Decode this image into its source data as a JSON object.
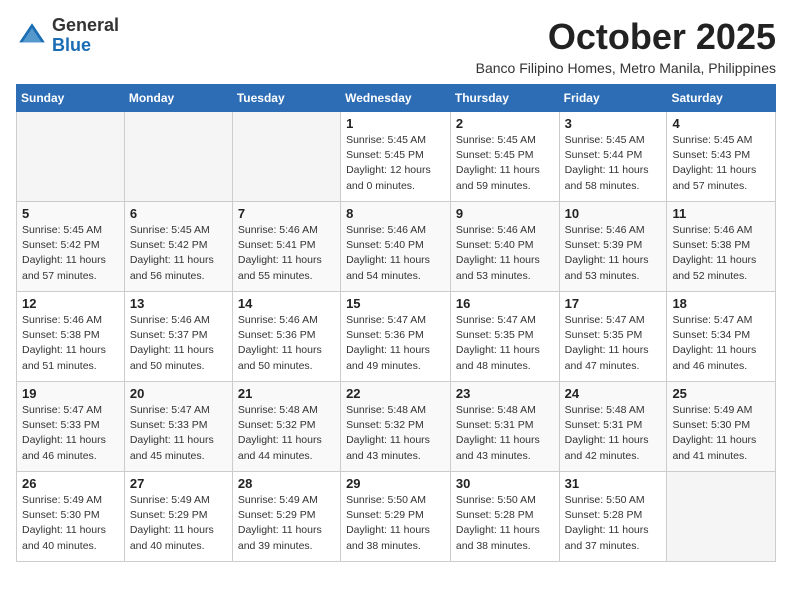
{
  "logo": {
    "general": "General",
    "blue": "Blue"
  },
  "title": "October 2025",
  "subtitle": "Banco Filipino Homes, Metro Manila, Philippines",
  "days_of_week": [
    "Sunday",
    "Monday",
    "Tuesday",
    "Wednesday",
    "Thursday",
    "Friday",
    "Saturday"
  ],
  "weeks": [
    [
      {
        "day": "",
        "info": ""
      },
      {
        "day": "",
        "info": ""
      },
      {
        "day": "",
        "info": ""
      },
      {
        "day": "1",
        "info": "Sunrise: 5:45 AM\nSunset: 5:45 PM\nDaylight: 12 hours\nand 0 minutes."
      },
      {
        "day": "2",
        "info": "Sunrise: 5:45 AM\nSunset: 5:45 PM\nDaylight: 11 hours\nand 59 minutes."
      },
      {
        "day": "3",
        "info": "Sunrise: 5:45 AM\nSunset: 5:44 PM\nDaylight: 11 hours\nand 58 minutes."
      },
      {
        "day": "4",
        "info": "Sunrise: 5:45 AM\nSunset: 5:43 PM\nDaylight: 11 hours\nand 57 minutes."
      }
    ],
    [
      {
        "day": "5",
        "info": "Sunrise: 5:45 AM\nSunset: 5:42 PM\nDaylight: 11 hours\nand 57 minutes."
      },
      {
        "day": "6",
        "info": "Sunrise: 5:45 AM\nSunset: 5:42 PM\nDaylight: 11 hours\nand 56 minutes."
      },
      {
        "day": "7",
        "info": "Sunrise: 5:46 AM\nSunset: 5:41 PM\nDaylight: 11 hours\nand 55 minutes."
      },
      {
        "day": "8",
        "info": "Sunrise: 5:46 AM\nSunset: 5:40 PM\nDaylight: 11 hours\nand 54 minutes."
      },
      {
        "day": "9",
        "info": "Sunrise: 5:46 AM\nSunset: 5:40 PM\nDaylight: 11 hours\nand 53 minutes."
      },
      {
        "day": "10",
        "info": "Sunrise: 5:46 AM\nSunset: 5:39 PM\nDaylight: 11 hours\nand 53 minutes."
      },
      {
        "day": "11",
        "info": "Sunrise: 5:46 AM\nSunset: 5:38 PM\nDaylight: 11 hours\nand 52 minutes."
      }
    ],
    [
      {
        "day": "12",
        "info": "Sunrise: 5:46 AM\nSunset: 5:38 PM\nDaylight: 11 hours\nand 51 minutes."
      },
      {
        "day": "13",
        "info": "Sunrise: 5:46 AM\nSunset: 5:37 PM\nDaylight: 11 hours\nand 50 minutes."
      },
      {
        "day": "14",
        "info": "Sunrise: 5:46 AM\nSunset: 5:36 PM\nDaylight: 11 hours\nand 50 minutes."
      },
      {
        "day": "15",
        "info": "Sunrise: 5:47 AM\nSunset: 5:36 PM\nDaylight: 11 hours\nand 49 minutes."
      },
      {
        "day": "16",
        "info": "Sunrise: 5:47 AM\nSunset: 5:35 PM\nDaylight: 11 hours\nand 48 minutes."
      },
      {
        "day": "17",
        "info": "Sunrise: 5:47 AM\nSunset: 5:35 PM\nDaylight: 11 hours\nand 47 minutes."
      },
      {
        "day": "18",
        "info": "Sunrise: 5:47 AM\nSunset: 5:34 PM\nDaylight: 11 hours\nand 46 minutes."
      }
    ],
    [
      {
        "day": "19",
        "info": "Sunrise: 5:47 AM\nSunset: 5:33 PM\nDaylight: 11 hours\nand 46 minutes."
      },
      {
        "day": "20",
        "info": "Sunrise: 5:47 AM\nSunset: 5:33 PM\nDaylight: 11 hours\nand 45 minutes."
      },
      {
        "day": "21",
        "info": "Sunrise: 5:48 AM\nSunset: 5:32 PM\nDaylight: 11 hours\nand 44 minutes."
      },
      {
        "day": "22",
        "info": "Sunrise: 5:48 AM\nSunset: 5:32 PM\nDaylight: 11 hours\nand 43 minutes."
      },
      {
        "day": "23",
        "info": "Sunrise: 5:48 AM\nSunset: 5:31 PM\nDaylight: 11 hours\nand 43 minutes."
      },
      {
        "day": "24",
        "info": "Sunrise: 5:48 AM\nSunset: 5:31 PM\nDaylight: 11 hours\nand 42 minutes."
      },
      {
        "day": "25",
        "info": "Sunrise: 5:49 AM\nSunset: 5:30 PM\nDaylight: 11 hours\nand 41 minutes."
      }
    ],
    [
      {
        "day": "26",
        "info": "Sunrise: 5:49 AM\nSunset: 5:30 PM\nDaylight: 11 hours\nand 40 minutes."
      },
      {
        "day": "27",
        "info": "Sunrise: 5:49 AM\nSunset: 5:29 PM\nDaylight: 11 hours\nand 40 minutes."
      },
      {
        "day": "28",
        "info": "Sunrise: 5:49 AM\nSunset: 5:29 PM\nDaylight: 11 hours\nand 39 minutes."
      },
      {
        "day": "29",
        "info": "Sunrise: 5:50 AM\nSunset: 5:29 PM\nDaylight: 11 hours\nand 38 minutes."
      },
      {
        "day": "30",
        "info": "Sunrise: 5:50 AM\nSunset: 5:28 PM\nDaylight: 11 hours\nand 38 minutes."
      },
      {
        "day": "31",
        "info": "Sunrise: 5:50 AM\nSunset: 5:28 PM\nDaylight: 11 hours\nand 37 minutes."
      },
      {
        "day": "",
        "info": ""
      }
    ]
  ]
}
